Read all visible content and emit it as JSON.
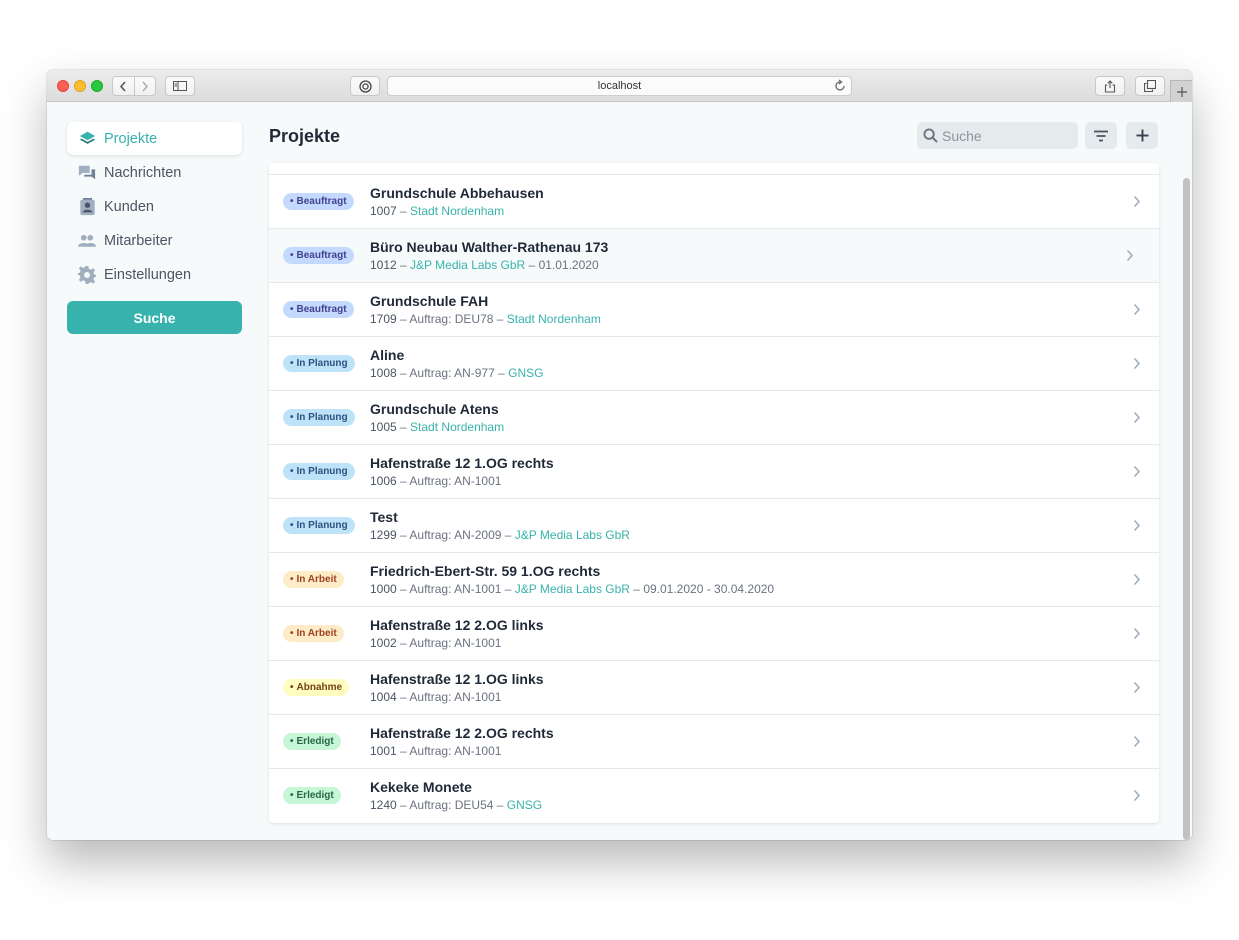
{
  "browser": {
    "url": "localhost"
  },
  "colors": {
    "accent": "#38b2ac",
    "beauftragt_bg": "#c3dafe",
    "beauftragt_fg": "#434190",
    "in_planung_bg": "#bee3f8",
    "in_planung_fg": "#2c5282",
    "in_arbeit_bg": "#feebc8",
    "in_arbeit_fg": "#9c4221",
    "abnahme_bg": "#fefcbf",
    "abnahme_fg": "#744210",
    "erledigt_bg": "#c6f6d5",
    "erledigt_fg": "#276749"
  },
  "sidebar": {
    "items": [
      {
        "label": "Projekte",
        "icon": "layers-icon",
        "active": true
      },
      {
        "label": "Nachrichten",
        "icon": "chat-icon",
        "active": false
      },
      {
        "label": "Kunden",
        "icon": "contact-card-icon",
        "active": false
      },
      {
        "label": "Mitarbeiter",
        "icon": "users-icon",
        "active": false
      },
      {
        "label": "Einstellungen",
        "icon": "gear-icon",
        "active": false
      }
    ],
    "search_button": "Suche"
  },
  "main": {
    "title": "Projekte",
    "search_placeholder": "Suche",
    "rows": [
      {
        "status": "Beauftragt",
        "title": "Grundschule Abbehausen",
        "number": "1007",
        "parts": [
          {
            "text": "Stadt Nordenham",
            "link": true
          }
        ]
      },
      {
        "status": "Beauftragt",
        "title": "Büro Neubau Walther-Rathenau 173",
        "number": "1012",
        "parts": [
          {
            "text": "J&P Media Labs GbR",
            "link": true
          },
          {
            "text": "01.01.2020",
            "link": false
          }
        ]
      },
      {
        "status": "Beauftragt",
        "title": "Grundschule FAH",
        "number": "1709",
        "parts": [
          {
            "text": "Auftrag: DEU78",
            "link": false
          },
          {
            "text": "Stadt Nordenham",
            "link": true
          }
        ]
      },
      {
        "status": "In Planung",
        "title": "Aline",
        "number": "1008",
        "parts": [
          {
            "text": "Auftrag: AN-977",
            "link": false
          },
          {
            "text": "GNSG",
            "link": true
          }
        ]
      },
      {
        "status": "In Planung",
        "title": "Grundschule Atens",
        "number": "1005",
        "parts": [
          {
            "text": "Stadt Nordenham",
            "link": true
          }
        ]
      },
      {
        "status": "In Planung",
        "title": "Hafenstraße 12 1.OG rechts",
        "number": "1006",
        "parts": [
          {
            "text": "Auftrag: AN-1001",
            "link": false
          }
        ]
      },
      {
        "status": "In Planung",
        "title": "Test",
        "number": "1299",
        "parts": [
          {
            "text": "Auftrag: AN-2009",
            "link": false
          },
          {
            "text": "J&P Media Labs GbR",
            "link": true
          }
        ]
      },
      {
        "status": "In Arbeit",
        "title": "Friedrich-Ebert-Str. 59 1.OG rechts",
        "number": "1000",
        "parts": [
          {
            "text": "Auftrag: AN-1001",
            "link": false
          },
          {
            "text": "J&P Media Labs GbR",
            "link": true
          },
          {
            "text": "09.01.2020 - 30.04.2020",
            "link": false
          }
        ]
      },
      {
        "status": "In Arbeit",
        "title": "Hafenstraße 12 2.OG links",
        "number": "1002",
        "parts": [
          {
            "text": "Auftrag: AN-1001",
            "link": false
          }
        ]
      },
      {
        "status": "Abnahme",
        "title": "Hafenstraße 12 1.OG links",
        "number": "1004",
        "parts": [
          {
            "text": "Auftrag: AN-1001",
            "link": false
          }
        ]
      },
      {
        "status": "Erledigt",
        "title": "Hafenstraße 12 2.OG rechts",
        "number": "1001",
        "parts": [
          {
            "text": "Auftrag: AN-1001",
            "link": false
          }
        ]
      },
      {
        "status": "Erledigt",
        "title": "Kekeke Monete",
        "number": "1240",
        "parts": [
          {
            "text": "Auftrag: DEU54",
            "link": false
          },
          {
            "text": "GNSG",
            "link": true
          }
        ]
      }
    ]
  }
}
